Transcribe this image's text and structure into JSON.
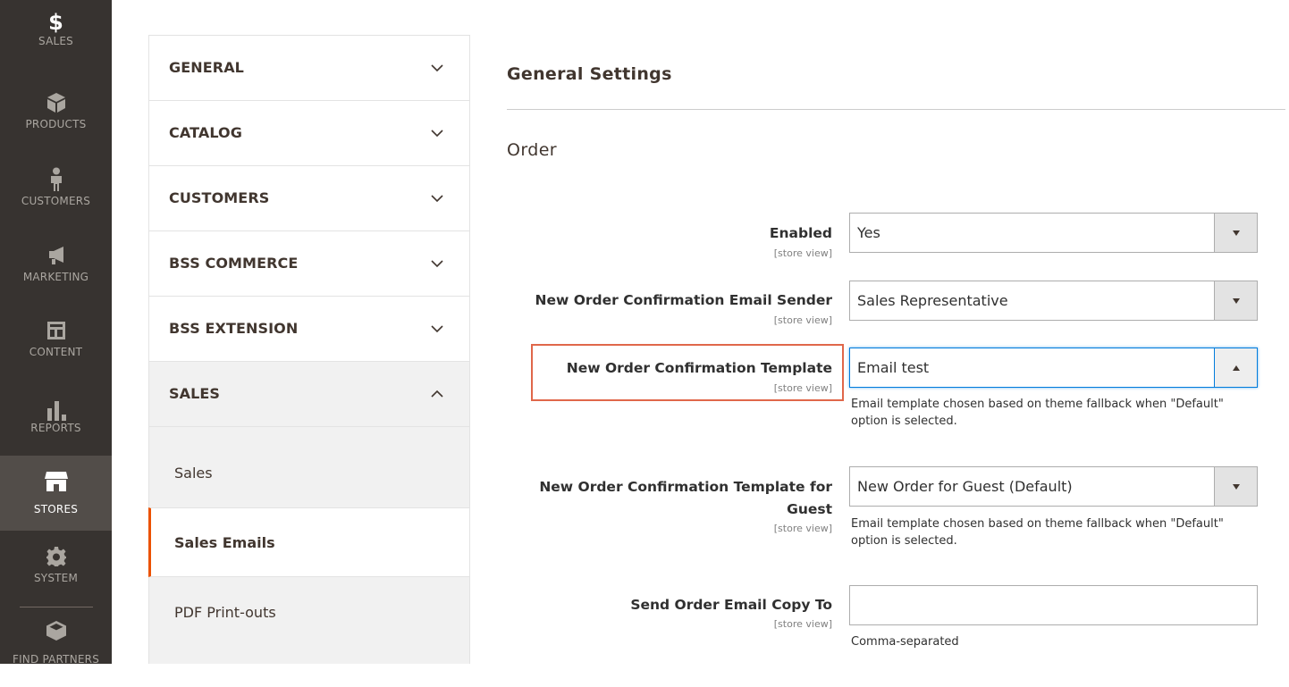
{
  "admin_nav": {
    "items": [
      {
        "label": "SALES",
        "icon": "dollar-icon"
      },
      {
        "label": "PRODUCTS",
        "icon": "box-icon"
      },
      {
        "label": "CUSTOMERS",
        "icon": "person-icon"
      },
      {
        "label": "MARKETING",
        "icon": "megaphone-icon"
      },
      {
        "label": "CONTENT",
        "icon": "layout-icon"
      },
      {
        "label": "REPORTS",
        "icon": "bar-chart-icon"
      },
      {
        "label": "STORES",
        "icon": "storefront-icon",
        "active": true
      },
      {
        "label": "SYSTEM",
        "icon": "gear-icon"
      },
      {
        "label": "FIND PARTNERS",
        "icon": "cube-icon"
      }
    ],
    "dollar_glyph": "$"
  },
  "config_tabs": {
    "sections": [
      {
        "title": "GENERAL",
        "expanded": false
      },
      {
        "title": "CATALOG",
        "expanded": false
      },
      {
        "title": "CUSTOMERS",
        "expanded": false
      },
      {
        "title": "BSS COMMERCE",
        "expanded": false
      },
      {
        "title": "BSS EXTENSION",
        "expanded": false
      },
      {
        "title": "SALES",
        "expanded": true
      }
    ],
    "sales_items": [
      {
        "label": "Sales",
        "current": false
      },
      {
        "label": "Sales Emails",
        "current": true
      },
      {
        "label": "PDF Print-outs",
        "current": false
      }
    ]
  },
  "main": {
    "section_title": "General Settings",
    "group_title": "Order",
    "fields": [
      {
        "label": "Enabled",
        "scope": "[store view]",
        "value": "Yes",
        "type": "select"
      },
      {
        "label": "New Order Confirmation Email Sender",
        "scope": "[store view]",
        "value": "Sales Representative",
        "type": "select"
      },
      {
        "label": "New Order Confirmation Template",
        "scope": "[store view]",
        "value": "Email test",
        "type": "select",
        "focused": true,
        "note": "Email template chosen based on theme fallback when \"Default\" option is selected."
      },
      {
        "label_line1": "New Order Confirmation Template for",
        "label_line2": "Guest",
        "scope": "[store view]",
        "value": "New Order for Guest (Default)",
        "type": "select",
        "note": "Email template chosen based on theme fallback when \"Default\" option is selected."
      },
      {
        "label": "Send Order Email Copy To",
        "scope": "[store view]",
        "value": "",
        "type": "text",
        "note": "Comma-separated"
      }
    ]
  },
  "colors": {
    "nav_bg": "#373330",
    "nav_active": "#524d49",
    "accent": "#eb5202",
    "highlight": "#e0674a",
    "focus": "#007bdb"
  }
}
